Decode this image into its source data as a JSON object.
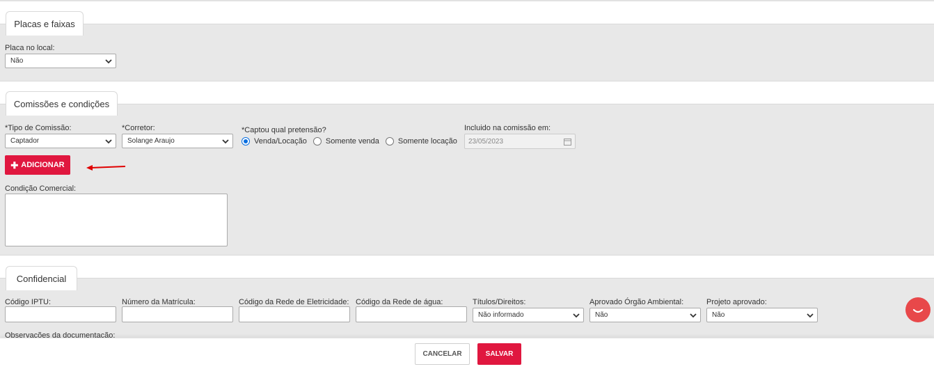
{
  "sections": {
    "placas": {
      "tab": "Placas e faixas",
      "placa_label": "Placa no local:",
      "placa_value": "Não"
    },
    "comissoes": {
      "tab": "Comissões e condições",
      "tipo_label": "*Tipo de Comissão:",
      "tipo_value": "Captador",
      "corretor_label": "*Corretor:",
      "corretor_value": "Solange Araujo",
      "pretensao_label": "*Captou qual pretensão?",
      "pretensao_options": [
        "Venda/Locação",
        "Somente venda",
        "Somente locação"
      ],
      "pretensao_selected": "Venda/Locação",
      "incluido_label": "Incluido na comissão em:",
      "incluido_value": "23/05/2023",
      "add_button": "ADICIONAR",
      "condicao_label": "Condição Comercial:"
    },
    "confidencial": {
      "tab": "Confidencial",
      "iptu_label": "Código IPTU:",
      "matricula_label": "Número da Matrícula:",
      "eletricidade_label": "Código da Rede de Eletricidade:",
      "agua_label": "Código da Rede de água:",
      "titulos_label": "Títulos/Direitos:",
      "titulos_value": "Não informado",
      "ambiental_label": "Aprovado Órgão Ambiental:",
      "ambiental_value": "Não",
      "projeto_label": "Projeto aprovado:",
      "projeto_value": "Não",
      "observacoes_label": "Observações da documentação:"
    }
  },
  "footer": {
    "cancel": "CANCELAR",
    "save": "SALVAR"
  },
  "colors": {
    "accent": "#e0173f",
    "radio": "#0a6fe0",
    "panel": "#e8e8e8",
    "chat": "#e8484a"
  }
}
